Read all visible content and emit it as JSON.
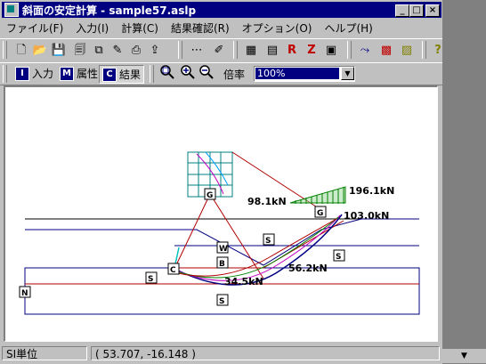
{
  "window": {
    "title": "斜面の安定計算 - sample57.aslp",
    "min_glyph": "_",
    "max_glyph": "□",
    "close_glyph": "×"
  },
  "menu": [
    {
      "label": "ファイル(F)"
    },
    {
      "label": "入力(I)"
    },
    {
      "label": "計算(C)"
    },
    {
      "label": "結果確認(R)"
    },
    {
      "label": "オプション(O)"
    },
    {
      "label": "ヘルプ(H)"
    }
  ],
  "toolbar": {
    "icons": [
      {
        "name": "new-file-icon",
        "glyph": "🗋"
      },
      {
        "name": "open-folder-icon",
        "glyph": "📂"
      },
      {
        "name": "save-icon",
        "glyph": "💾"
      },
      {
        "name": "print-preview-icon",
        "glyph": "🗐"
      },
      {
        "name": "copy-icon",
        "glyph": "⧉"
      },
      {
        "name": "edit-icon",
        "glyph": "✎"
      },
      {
        "name": "print-icon",
        "glyph": "⎙"
      },
      {
        "name": "export-icon",
        "glyph": "⇪"
      },
      {
        "name": "points-icon",
        "glyph": "⋯"
      },
      {
        "name": "line-icon",
        "glyph": "✐"
      },
      {
        "name": "calc-settings-icon",
        "glyph": "▦"
      },
      {
        "name": "table-icon",
        "glyph": "▤"
      },
      {
        "name": "result-r-icon",
        "glyph": "R"
      },
      {
        "name": "result-z-icon",
        "glyph": "Z"
      },
      {
        "name": "result-view-icon",
        "glyph": "▣"
      },
      {
        "name": "graph-icon",
        "glyph": "⤳"
      },
      {
        "name": "color-icon",
        "glyph": "▩"
      },
      {
        "name": "palette-icon",
        "glyph": "▨"
      },
      {
        "name": "help-icon",
        "glyph": "?"
      }
    ]
  },
  "modes": {
    "input": {
      "key": "I",
      "label": "入力"
    },
    "attribute": {
      "key": "M",
      "label": "属性"
    },
    "result": {
      "key": "C",
      "label": "結果"
    }
  },
  "zoom": {
    "label": "倍率",
    "value": "100%"
  },
  "drawing": {
    "load_left": "98.1kN",
    "load_right": "196.1kN",
    "force_top": "103.0kN",
    "force_mid": "56.2kN",
    "force_bottom": "34.5kN",
    "tags": {
      "g1": "G",
      "g2": "G",
      "c": "C",
      "w": "W",
      "b": "B",
      "s1": "S",
      "s2": "S",
      "s3": "S",
      "s4": "S",
      "n": "N"
    },
    "colors": {
      "surface": "#000080",
      "slip": "#b00000",
      "grid": "#008080",
      "load": "#008000"
    }
  },
  "status": {
    "units": "SI単位",
    "coords": "(  53.707,  -16.148 )"
  }
}
